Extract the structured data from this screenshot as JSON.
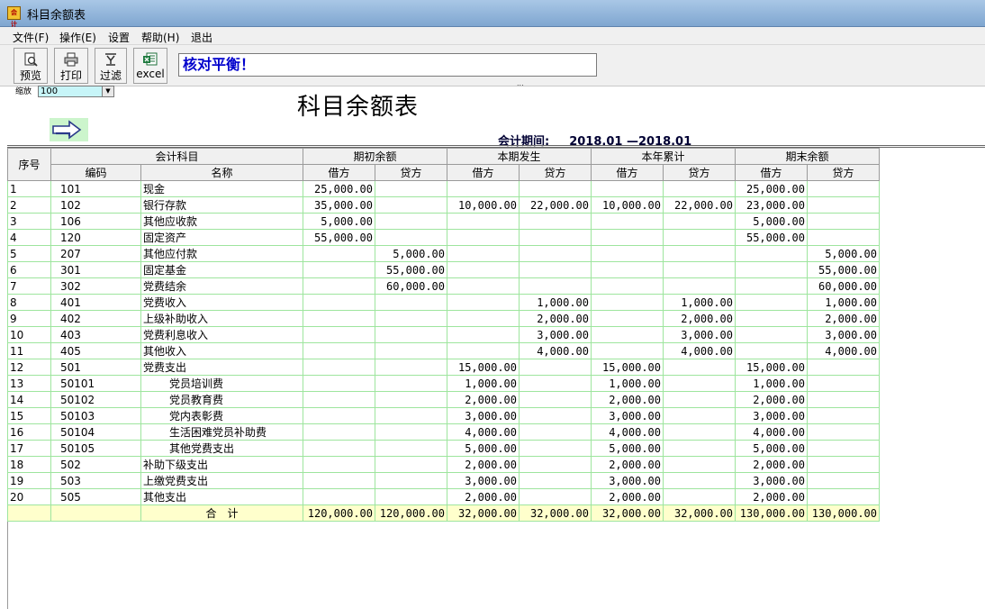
{
  "window": {
    "title": "科目余额表",
    "icon_text": "会计"
  },
  "menu": [
    "文件(F)",
    "操作(E)",
    "设置",
    "帮助(H)",
    "退出"
  ],
  "toolbar": {
    "buttons": [
      {
        "label": "预览",
        "icon": "preview-icon"
      },
      {
        "label": "打印",
        "icon": "print-icon"
      },
      {
        "label": "过滤",
        "icon": "filter-icon"
      },
      {
        "label": "excel",
        "icon": "excel-icon"
      }
    ],
    "message": "核对平衡！",
    "grip": "..."
  },
  "zoom": {
    "label": "缩放",
    "value": "100"
  },
  "report": {
    "title": "科目余额表",
    "period_label": "会计期间:",
    "period_value": "2018.01 —2018.01"
  },
  "table": {
    "headers": {
      "seq": "序号",
      "account": "会计科目",
      "code": "编码",
      "name": "名称",
      "groups": [
        "期初余额",
        "本期发生",
        "本年累计",
        "期末余额"
      ],
      "debit": "借方",
      "credit": "贷方"
    },
    "rows": [
      {
        "seq": "1",
        "code": "101",
        "name": "现金",
        "level": 1,
        "values": [
          "25,000.00",
          "",
          "",
          "",
          "",
          "",
          "25,000.00",
          ""
        ]
      },
      {
        "seq": "2",
        "code": "102",
        "name": "银行存款",
        "level": 1,
        "values": [
          "35,000.00",
          "",
          "10,000.00",
          "22,000.00",
          "10,000.00",
          "22,000.00",
          "23,000.00",
          ""
        ]
      },
      {
        "seq": "3",
        "code": "106",
        "name": "其他应收款",
        "level": 1,
        "values": [
          "5,000.00",
          "",
          "",
          "",
          "",
          "",
          "5,000.00",
          ""
        ]
      },
      {
        "seq": "4",
        "code": "120",
        "name": "固定资产",
        "level": 1,
        "values": [
          "55,000.00",
          "",
          "",
          "",
          "",
          "",
          "55,000.00",
          ""
        ]
      },
      {
        "seq": "5",
        "code": "207",
        "name": "其他应付款",
        "level": 1,
        "values": [
          "",
          "5,000.00",
          "",
          "",
          "",
          "",
          "",
          "5,000.00"
        ]
      },
      {
        "seq": "6",
        "code": "301",
        "name": "固定基金",
        "level": 1,
        "values": [
          "",
          "55,000.00",
          "",
          "",
          "",
          "",
          "",
          "55,000.00"
        ]
      },
      {
        "seq": "7",
        "code": "302",
        "name": "党费结余",
        "level": 1,
        "values": [
          "",
          "60,000.00",
          "",
          "",
          "",
          "",
          "",
          "60,000.00"
        ]
      },
      {
        "seq": "8",
        "code": "401",
        "name": "党费收入",
        "level": 1,
        "values": [
          "",
          "",
          "",
          "1,000.00",
          "",
          "1,000.00",
          "",
          "1,000.00"
        ]
      },
      {
        "seq": "9",
        "code": "402",
        "name": "上级补助收入",
        "level": 1,
        "values": [
          "",
          "",
          "",
          "2,000.00",
          "",
          "2,000.00",
          "",
          "2,000.00"
        ]
      },
      {
        "seq": "10",
        "code": "403",
        "name": "党费利息收入",
        "level": 1,
        "values": [
          "",
          "",
          "",
          "3,000.00",
          "",
          "3,000.00",
          "",
          "3,000.00"
        ]
      },
      {
        "seq": "11",
        "code": "405",
        "name": "其他收入",
        "level": 1,
        "values": [
          "",
          "",
          "",
          "4,000.00",
          "",
          "4,000.00",
          "",
          "4,000.00"
        ]
      },
      {
        "seq": "12",
        "code": "501",
        "name": "党费支出",
        "level": 1,
        "values": [
          "",
          "",
          "15,000.00",
          "",
          "15,000.00",
          "",
          "15,000.00",
          ""
        ]
      },
      {
        "seq": "13",
        "code": "50101",
        "name": "党员培训费",
        "level": 2,
        "values": [
          "",
          "",
          "1,000.00",
          "",
          "1,000.00",
          "",
          "1,000.00",
          ""
        ]
      },
      {
        "seq": "14",
        "code": "50102",
        "name": "党员教育费",
        "level": 2,
        "values": [
          "",
          "",
          "2,000.00",
          "",
          "2,000.00",
          "",
          "2,000.00",
          ""
        ]
      },
      {
        "seq": "15",
        "code": "50103",
        "name": "党内表彰费",
        "level": 2,
        "values": [
          "",
          "",
          "3,000.00",
          "",
          "3,000.00",
          "",
          "3,000.00",
          ""
        ]
      },
      {
        "seq": "16",
        "code": "50104",
        "name": "生活困难党员补助费",
        "level": 2,
        "values": [
          "",
          "",
          "4,000.00",
          "",
          "4,000.00",
          "",
          "4,000.00",
          ""
        ]
      },
      {
        "seq": "17",
        "code": "50105",
        "name": "其他党费支出",
        "level": 2,
        "values": [
          "",
          "",
          "5,000.00",
          "",
          "5,000.00",
          "",
          "5,000.00",
          ""
        ]
      },
      {
        "seq": "18",
        "code": "502",
        "name": "补助下级支出",
        "level": 1,
        "values": [
          "",
          "",
          "2,000.00",
          "",
          "2,000.00",
          "",
          "2,000.00",
          ""
        ]
      },
      {
        "seq": "19",
        "code": "503",
        "name": "上缴党费支出",
        "level": 1,
        "values": [
          "",
          "",
          "3,000.00",
          "",
          "3,000.00",
          "",
          "3,000.00",
          ""
        ]
      },
      {
        "seq": "20",
        "code": "505",
        "name": "其他支出",
        "level": 1,
        "values": [
          "",
          "",
          "2,000.00",
          "",
          "2,000.00",
          "",
          "2,000.00",
          ""
        ]
      }
    ],
    "total": {
      "label": "合　计",
      "values": [
        "120,000.00",
        "120,000.00",
        "32,000.00",
        "32,000.00",
        "32,000.00",
        "32,000.00",
        "130,000.00",
        "130,000.00"
      ]
    }
  }
}
